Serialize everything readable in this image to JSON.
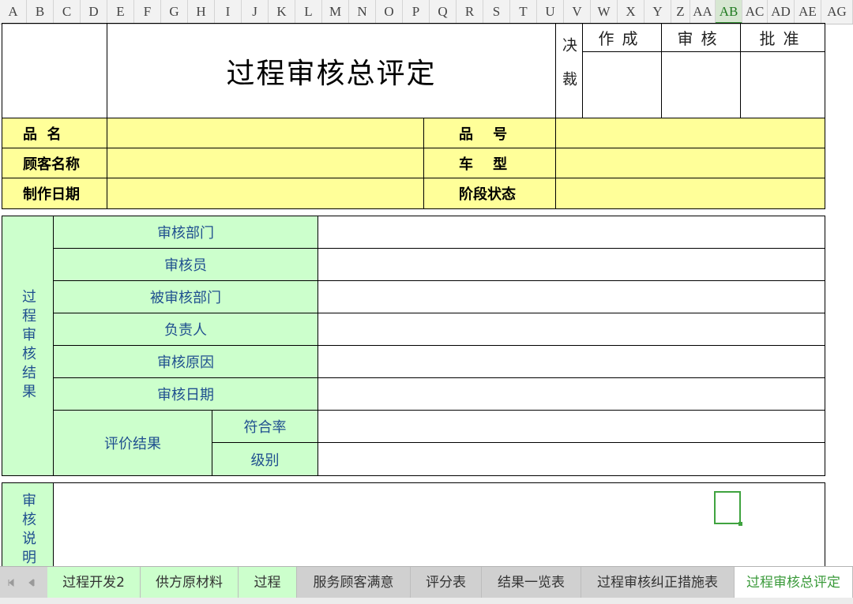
{
  "columns": [
    "A",
    "B",
    "C",
    "D",
    "E",
    "F",
    "G",
    "H",
    "I",
    "J",
    "K",
    "L",
    "M",
    "N",
    "O",
    "P",
    "Q",
    "R",
    "S",
    "T",
    "U",
    "V",
    "W",
    "X",
    "Y",
    "Z",
    "AA",
    "AB",
    "AC",
    "AD",
    "AE",
    "AG"
  ],
  "active_column": "AB",
  "form": {
    "title": "过程审核总评定",
    "decision_label": "决裁",
    "approval": {
      "created": "作成",
      "reviewed": "审核",
      "approved": "批准"
    },
    "info": {
      "product_name": "品  名",
      "product_number": "品    号",
      "customer_name": "顾客名称",
      "car_model": "车    型",
      "make_date": "制作日期",
      "stage_status": "阶段状态"
    },
    "results": {
      "section_label": "过程审核结果",
      "dept": "审核部门",
      "auditor": "审核员",
      "audited_dept": "被审核部门",
      "responsible": "负责人",
      "reason": "审核原因",
      "date": "审核日期",
      "evaluation": "评价结果",
      "compliance_rate": "符合率",
      "level": "级别"
    },
    "notes": {
      "section_label": "审核说明"
    }
  },
  "tabs": [
    {
      "label": "过程开发2",
      "style": "green"
    },
    {
      "label": "供方原材料",
      "style": "green"
    },
    {
      "label": "过程",
      "style": "green"
    },
    {
      "label": "服务顾客满意",
      "style": "grey"
    },
    {
      "label": "评分表",
      "style": "grey"
    },
    {
      "label": "结果一览表",
      "style": "grey"
    },
    {
      "label": "过程审核纠正措施表",
      "style": "grey"
    },
    {
      "label": "过程审核总评定",
      "style": "active"
    }
  ],
  "colors": {
    "yellow": "#ffff99",
    "green": "#ccffcc",
    "accent": "#3a9a3a"
  },
  "icons": {
    "first_sheet": "first-sheet-icon",
    "prev_sheet": "prev-sheet-icon"
  }
}
